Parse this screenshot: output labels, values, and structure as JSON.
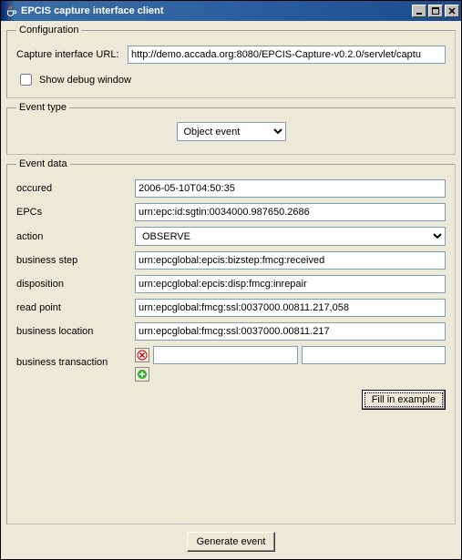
{
  "window": {
    "title": "EPCIS capture interface client",
    "min": "_",
    "max": "□",
    "close": "✕"
  },
  "config": {
    "legend": "Configuration",
    "url_label": "Capture interface URL:",
    "url_value": "http://demo.accada.org:8080/EPCIS-Capture-v0.2.0/servlet/captu",
    "debug_label": "Show debug window"
  },
  "eventtype": {
    "legend": "Event type",
    "selected": "Object event"
  },
  "eventdata": {
    "legend": "Event data",
    "occured": {
      "label": "occured",
      "value": "2006-05-10T04:50:35"
    },
    "epcs": {
      "label": "EPCs",
      "value": "urn:epc:id:sgtin:0034000.987650.2686"
    },
    "action": {
      "label": "action",
      "value": "OBSERVE"
    },
    "bizstep": {
      "label": "business step",
      "value": "urn:epcglobal:epcis:bizstep:fmcg:received"
    },
    "disposition": {
      "label": "disposition",
      "value": "urn:epcglobal:epcis:disp:fmcg:inrepair"
    },
    "readpoint": {
      "label": "read point",
      "value": "urn:epcglobal:fmcg:ssl:0037000.00811.217,058"
    },
    "bizlocation": {
      "label": "business location",
      "value": "urn:epcglobal:fmcg:ssl:0037000.00811.217"
    },
    "biztx": {
      "label": "business transaction",
      "v1": "",
      "v2": ""
    },
    "fill_label": "Fill in example",
    "generate_label": "Generate event"
  }
}
